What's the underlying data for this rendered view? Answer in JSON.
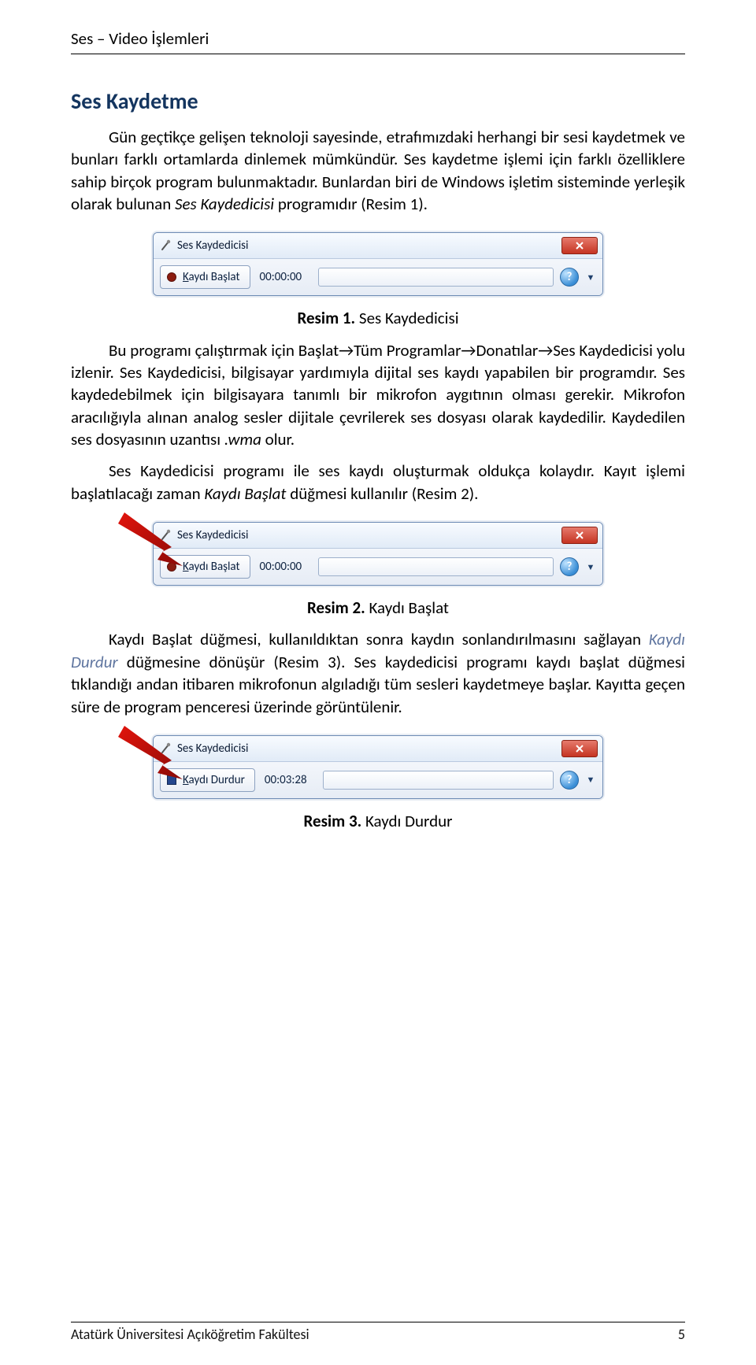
{
  "header": "Ses – Video İşlemleri",
  "section_title": "Ses Kaydetme",
  "p1": {
    "text_a": "Gün geçtikçe gelişen teknoloji sayesinde, etrafımızdaki herhangi bir sesi kaydetmek ve bunları farklı ortamlarda dinlemek mümkündür. Ses kaydetme işlemi için farklı özelliklere sahip birçok program bulunmaktadır. Bunlardan biri de Windows işletim sisteminde yerleşik olarak bulunan ",
    "italic_a": "Ses Kaydedicisi",
    "text_b": " programıdır (Resim 1)."
  },
  "recorder1": {
    "title": "Ses Kaydedicisi",
    "button": "Kaydı Başlat",
    "button_prefix": "K",
    "button_rest": "aydı Başlat",
    "time": "00:00:00"
  },
  "caption1": {
    "bold": "Resim 1.",
    "rest": " Ses Kaydedicisi"
  },
  "p2": {
    "text_a": "Bu programı çalıştırmak için Başlat→Tüm Programlar→Donatılar→Ses Kaydedicisi yolu izlenir. Ses Kaydedicisi, bilgisayar yardımıyla dijital ses kaydı yapabilen bir programdır. Ses kaydedebilmek için bilgisayara tanımlı bir mikrofon aygıtının olması gerekir. Mikrofon aracılığıyla alınan analog sesler dijitale çevrilerek ses dosyası olarak kaydedilir. Kaydedilen ses dosyasının uzantısı ",
    "italic_a": ".wma",
    "text_b": " olur."
  },
  "p3": {
    "text_a": "Ses Kaydedicisi programı ile ses kaydı oluşturmak oldukça kolaydır. Kayıt işlemi başlatılacağı zaman ",
    "italic_a": "Kaydı Başlat",
    "text_b": " düğmesi kullanılır (Resim 2)."
  },
  "recorder2": {
    "title": "Ses Kaydedicisi",
    "button": "Kaydı Başlat",
    "button_prefix": "K",
    "button_rest": "aydı Başlat",
    "time": "00:00:00"
  },
  "caption2": {
    "bold": "Resim 2.",
    "rest": " Kaydı Başlat"
  },
  "p4": {
    "text_a": "Kaydı Başlat düğmesi, kullanıldıktan sonra kaydın sonlandırılmasını sağlayan ",
    "italic_a": "Kaydı Durdur",
    "text_b": " düğmesine dönüşür (Resim 3). Ses kaydedicisi programı kaydı başlat düğmesi tıklandığı andan itibaren mikrofonun algıladığı tüm sesleri kaydetmeye başlar. Kayıtta geçen süre de program penceresi üzerinde görüntülenir."
  },
  "recorder3": {
    "title": "Ses Kaydedicisi",
    "button": "Kaydı Durdur",
    "button_prefix": "K",
    "button_rest": "aydı Durdur",
    "time": "00:03:28"
  },
  "caption3": {
    "bold": "Resim 3.",
    "rest": " Kaydı Durdur"
  },
  "footer": {
    "org": "Atatürk Üniversitesi Açıköğretim Fakültesi",
    "page": "5"
  }
}
